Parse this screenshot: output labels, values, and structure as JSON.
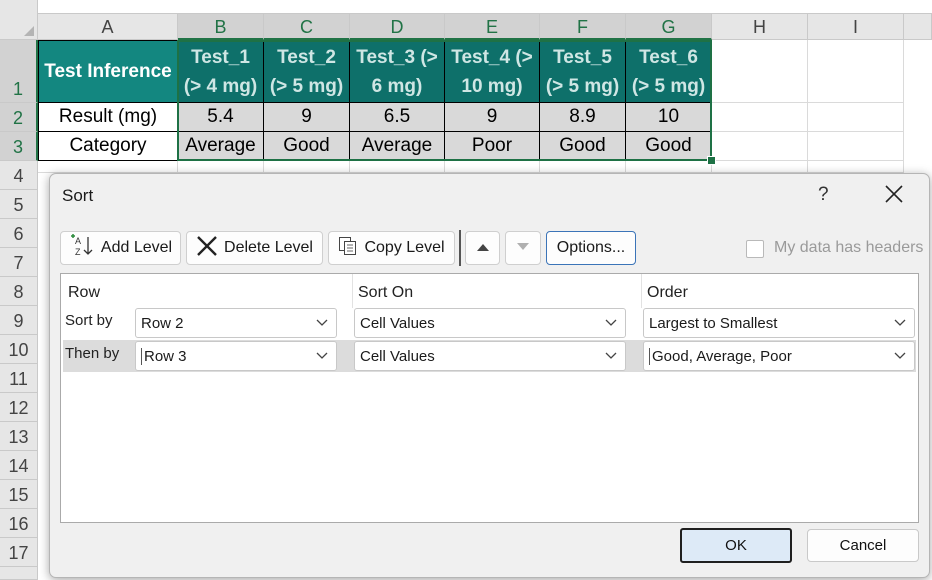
{
  "sheet": {
    "columns": [
      "A",
      "B",
      "C",
      "D",
      "E",
      "F",
      "G",
      "H",
      "I"
    ],
    "rows": [
      "1",
      "2",
      "3",
      "4",
      "5",
      "6",
      "7",
      "8",
      "9",
      "10",
      "11",
      "12",
      "13",
      "14",
      "15",
      "16",
      "17"
    ],
    "a1": "Test Inference",
    "a2": "Result (mg)",
    "a3": "Category",
    "tests": [
      {
        "name": "Test_1",
        "threshold": "(> 4 mg)",
        "result": "5.4",
        "category": "Average"
      },
      {
        "name": "Test_2",
        "threshold": "(> 5 mg)",
        "result": "9",
        "category": "Good"
      },
      {
        "name": "Test_3 (>",
        "threshold": "6 mg)",
        "result": "6.5",
        "category": "Average"
      },
      {
        "name": "Test_4 (>",
        "threshold": "10 mg)",
        "result": "9",
        "category": "Poor"
      },
      {
        "name": "Test_5",
        "threshold": "(> 5 mg)",
        "result": "8.9",
        "category": "Good"
      },
      {
        "name": "Test_6",
        "threshold": "(> 5 mg)",
        "result": "10",
        "category": "Good"
      }
    ],
    "colors": {
      "header_teal": "#138780",
      "selection_green": "#1e7145",
      "grey_fill": "#d9d9d9"
    }
  },
  "dialog": {
    "title": "Sort",
    "help": "?",
    "toolbar": {
      "add_level": "Add Level",
      "delete_level": "Delete Level",
      "copy_level": "Copy Level",
      "options": "Options...",
      "my_data_has_headers": "My data has headers",
      "my_data_has_headers_checked": false
    },
    "columns": {
      "row": "Row",
      "sort_on": "Sort On",
      "order": "Order"
    },
    "levels": [
      {
        "label": "Sort by",
        "row": "Row 2",
        "sort_on": "Cell Values",
        "order": "Largest to Smallest"
      },
      {
        "label": "Then by",
        "row": "Row 3",
        "sort_on": "Cell Values",
        "order": "Good, Average, Poor"
      }
    ],
    "ok": "OK",
    "cancel": "Cancel"
  }
}
